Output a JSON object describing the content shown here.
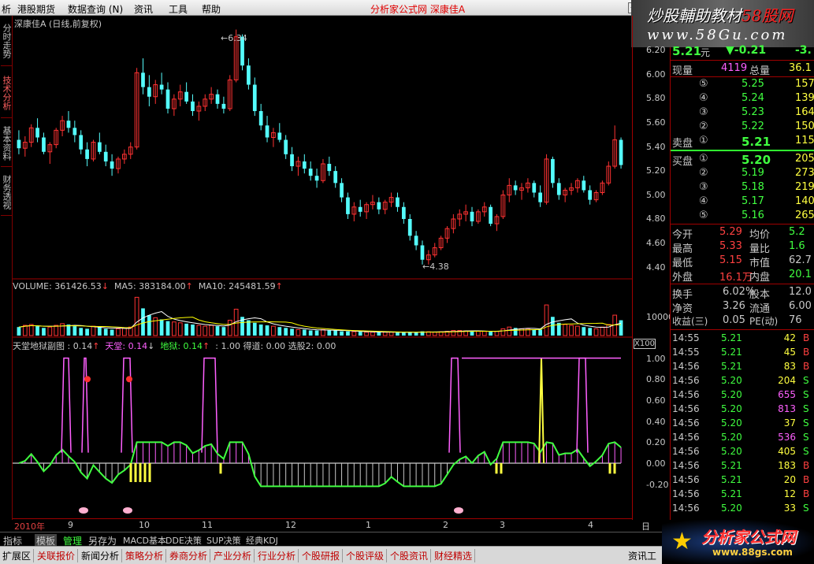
{
  "menu": {
    "items": [
      "析",
      "港股期货",
      "数据查询 (N)",
      "资讯",
      "工具",
      "帮助"
    ],
    "app_title": "分析家公式网  深康佳A",
    "min_button": "—"
  },
  "watermark": {
    "line1_a": "炒股輔助教材",
    "line1_b": "58股网",
    "line2": "www.58Gu.com"
  },
  "left_tabs": [
    "分时走势",
    "技术分析",
    "基本资料",
    "财务透视"
  ],
  "price_panel": {
    "title": "深康佳A (日线,前复权)",
    "high_label": "6.34",
    "low_label": "4.38",
    "y_ticks": [
      "6.20",
      "6.00",
      "5.80",
      "5.60",
      "5.40",
      "5.20",
      "5.00",
      "4.80",
      "4.60",
      "4.40"
    ]
  },
  "volume_panel": {
    "vol_label": "VOLUME: 361426.53",
    "ma5_label": "MA5: 383184.00",
    "ma10_label": "MA10: 245481.59",
    "y_tick": "10000",
    "y_unit": "X100"
  },
  "indicator_panel": {
    "name": "天堂地狱副图 : 0.14",
    "tiantang": "天堂: 0.14",
    "diyu": "地狱: 0.14",
    "rest": ": 1.00 得道: 0.00 选股2: 0.00",
    "y_ticks": [
      "1.00",
      "0.80",
      "0.60",
      "0.40",
      "0.20",
      "0.00",
      "-0.20"
    ]
  },
  "x_axis": {
    "labels": [
      "2010年",
      "9",
      "10",
      "11",
      "12",
      "1",
      "2",
      "3",
      "4"
    ],
    "period": "日线"
  },
  "quote": {
    "price": "5.21",
    "unit": "元",
    "change": "▼-0.21",
    "pct": "-3.",
    "xianliang_label": "现量",
    "xianliang": "4119",
    "zongliang_label": "总量",
    "zongliang": "36.1",
    "sell_label": "卖盘",
    "buy_label": "买盘",
    "sells": [
      {
        "lvl": "⑤",
        "price": "5.25",
        "vol": "157"
      },
      {
        "lvl": "④",
        "price": "5.24",
        "vol": "139"
      },
      {
        "lvl": "③",
        "price": "5.23",
        "vol": "164"
      },
      {
        "lvl": "②",
        "price": "5.22",
        "vol": "150"
      },
      {
        "lvl": "①",
        "price": "5.21",
        "vol": "115"
      }
    ],
    "buys": [
      {
        "lvl": "①",
        "price": "5.20",
        "vol": "205"
      },
      {
        "lvl": "②",
        "price": "5.19",
        "vol": "273"
      },
      {
        "lvl": "③",
        "price": "5.18",
        "vol": "219"
      },
      {
        "lvl": "④",
        "price": "5.17",
        "vol": "140"
      },
      {
        "lvl": "⑤",
        "price": "5.16",
        "vol": "265"
      }
    ],
    "stats": [
      {
        "k1": "今开",
        "v1": "5.29",
        "k2": "均价",
        "v2": "5.2"
      },
      {
        "k1": "最高",
        "v1": "5.33",
        "k2": "量比",
        "v2": "1.6"
      },
      {
        "k1": "最低",
        "v1": "5.15",
        "k2": "市值",
        "v2": "62.7"
      },
      {
        "k1": "外盘",
        "v1": "16.1万",
        "k2": "内盘",
        "v2": "20.1"
      }
    ],
    "stats2": [
      {
        "k1": "换手",
        "v1": "6.02%",
        "k2": "股本",
        "v2": "12.0"
      },
      {
        "k1": "净资",
        "v1": "3.26",
        "k2": "流通",
        "v2": "6.00"
      },
      {
        "k1": "收益(三)",
        "v1": "0.05",
        "k2": "PE(动)",
        "v2": "76"
      }
    ],
    "ticks": [
      {
        "t": "14:55",
        "p": "5.21",
        "v": "42",
        "s": "B"
      },
      {
        "t": "14:55",
        "p": "5.21",
        "v": "45",
        "s": "B"
      },
      {
        "t": "14:56",
        "p": "5.21",
        "v": "83",
        "s": "B"
      },
      {
        "t": "14:56",
        "p": "5.20",
        "v": "204",
        "s": "S"
      },
      {
        "t": "14:56",
        "p": "5.20",
        "v": "655",
        "s": "S"
      },
      {
        "t": "14:56",
        "p": "5.20",
        "v": "813",
        "s": "S"
      },
      {
        "t": "14:56",
        "p": "5.20",
        "v": "37",
        "s": "S"
      },
      {
        "t": "14:56",
        "p": "5.20",
        "v": "536",
        "s": "S"
      },
      {
        "t": "14:56",
        "p": "5.20",
        "v": "405",
        "s": "S"
      },
      {
        "t": "14:56",
        "p": "5.21",
        "v": "183",
        "s": "B"
      },
      {
        "t": "14:56",
        "p": "5.21",
        "v": "20",
        "s": "B"
      },
      {
        "t": "14:56",
        "p": "5.21",
        "v": "12",
        "s": "B"
      },
      {
        "t": "14:56",
        "p": "5.20",
        "v": "33",
        "s": "S"
      }
    ]
  },
  "bottom_tabs": [
    "指标",
    "模板",
    "管理",
    "另存为",
    "MACD基本",
    "DDE决策",
    "SUP决策",
    "经典KDJ"
  ],
  "bottom_bar": [
    "扩展区",
    "关联报价",
    "新闻分析",
    "策略分析",
    "券商分析",
    "产业分析",
    "行业分析",
    "个股研报",
    "个股评级",
    "个股资讯",
    "财经精选",
    "资讯工"
  ],
  "logo": {
    "line1": "分析家公式网",
    "line2": "www.88gs.com"
  },
  "colors": {
    "up": "#ff3232",
    "down": "#54fcfc",
    "ma_white": "#ffffff",
    "ma_yellow": "#ffff00",
    "pink": "#ff60ff",
    "green": "#40ff40",
    "axis_red": "#a00000"
  },
  "chart_data": [
    {
      "type": "candlestick",
      "title": "深康佳A (日线,前复权)",
      "ylim": [
        4.3,
        6.35
      ],
      "ohlc": [
        [
          5.42,
          5.5,
          5.3,
          5.35
        ],
        [
          5.35,
          5.45,
          5.28,
          5.4
        ],
        [
          5.4,
          5.55,
          5.36,
          5.52
        ],
        [
          5.52,
          5.6,
          5.4,
          5.44
        ],
        [
          5.44,
          5.48,
          5.3,
          5.32
        ],
        [
          5.32,
          5.4,
          5.22,
          5.38
        ],
        [
          5.38,
          5.52,
          5.35,
          5.5
        ],
        [
          5.5,
          5.62,
          5.45,
          5.58
        ],
        [
          5.58,
          5.66,
          5.48,
          5.52
        ],
        [
          5.52,
          5.58,
          5.4,
          5.46
        ],
        [
          5.46,
          5.5,
          5.3,
          5.34
        ],
        [
          5.34,
          5.4,
          5.2,
          5.26
        ],
        [
          5.26,
          5.42,
          5.24,
          5.4
        ],
        [
          5.4,
          5.48,
          5.3,
          5.32
        ],
        [
          5.32,
          5.38,
          5.2,
          5.24
        ],
        [
          5.24,
          5.3,
          5.12,
          5.18
        ],
        [
          5.18,
          5.28,
          5.14,
          5.26
        ],
        [
          5.26,
          5.34,
          5.22,
          5.3
        ],
        [
          5.3,
          5.4,
          5.26,
          5.36
        ],
        [
          5.36,
          6.02,
          5.34,
          5.98
        ],
        [
          5.98,
          6.1,
          5.8,
          5.86
        ],
        [
          5.86,
          5.96,
          5.7,
          5.78
        ],
        [
          5.78,
          5.92,
          5.72,
          5.88
        ],
        [
          5.88,
          5.98,
          5.8,
          5.84
        ],
        [
          5.84,
          5.9,
          5.64,
          5.68
        ],
        [
          5.68,
          5.8,
          5.62,
          5.76
        ],
        [
          5.76,
          5.88,
          5.7,
          5.82
        ],
        [
          5.82,
          5.9,
          5.72,
          5.74
        ],
        [
          5.74,
          5.8,
          5.62,
          5.66
        ],
        [
          5.66,
          5.74,
          5.58,
          5.7
        ],
        [
          5.7,
          5.8,
          5.66,
          5.76
        ],
        [
          5.76,
          5.86,
          5.72,
          5.8
        ],
        [
          5.8,
          5.84,
          5.68,
          5.72
        ],
        [
          5.72,
          5.78,
          5.64,
          5.68
        ],
        [
          5.68,
          5.96,
          5.66,
          5.92
        ],
        [
          5.92,
          6.34,
          5.9,
          6.28
        ],
        [
          6.28,
          6.3,
          6.0,
          6.04
        ],
        [
          6.04,
          6.1,
          5.84,
          5.88
        ],
        [
          5.88,
          5.94,
          5.62,
          5.66
        ],
        [
          5.66,
          5.72,
          5.5,
          5.54
        ],
        [
          5.54,
          5.62,
          5.4,
          5.44
        ],
        [
          5.44,
          5.52,
          5.36,
          5.48
        ],
        [
          5.48,
          5.56,
          5.4,
          5.42
        ],
        [
          5.42,
          5.46,
          5.26,
          5.3
        ],
        [
          5.3,
          5.36,
          5.16,
          5.2
        ],
        [
          5.2,
          5.28,
          5.12,
          5.24
        ],
        [
          5.24,
          5.3,
          5.14,
          5.18
        ],
        [
          5.18,
          5.24,
          5.08,
          5.12
        ],
        [
          5.12,
          5.18,
          5.02,
          5.08
        ],
        [
          5.08,
          5.26,
          5.06,
          5.22
        ],
        [
          5.22,
          5.28,
          5.12,
          5.16
        ],
        [
          5.16,
          5.2,
          5.02,
          5.06
        ],
        [
          5.06,
          5.1,
          4.9,
          4.94
        ],
        [
          4.94,
          4.98,
          4.76,
          4.8
        ],
        [
          4.8,
          4.9,
          4.74,
          4.86
        ],
        [
          4.86,
          4.92,
          4.78,
          4.82
        ],
        [
          4.82,
          4.9,
          4.76,
          4.88
        ],
        [
          4.88,
          4.96,
          4.84,
          4.9
        ],
        [
          4.9,
          4.94,
          4.8,
          4.84
        ],
        [
          4.84,
          4.92,
          4.8,
          4.9
        ],
        [
          4.9,
          4.98,
          4.86,
          4.94
        ],
        [
          4.94,
          4.98,
          4.82,
          4.86
        ],
        [
          4.86,
          4.9,
          4.72,
          4.76
        ],
        [
          4.76,
          4.8,
          4.58,
          4.62
        ],
        [
          4.62,
          4.66,
          4.5,
          4.54
        ],
        [
          4.54,
          4.58,
          4.38,
          4.42
        ],
        [
          4.42,
          4.5,
          4.38,
          4.46
        ],
        [
          4.46,
          4.56,
          4.44,
          4.52
        ],
        [
          4.52,
          4.62,
          4.5,
          4.6
        ],
        [
          4.6,
          4.7,
          4.56,
          4.68
        ],
        [
          4.68,
          4.8,
          4.64,
          4.76
        ],
        [
          4.76,
          4.84,
          4.7,
          4.8
        ],
        [
          4.8,
          4.88,
          4.74,
          4.82
        ],
        [
          4.82,
          4.86,
          4.7,
          4.74
        ],
        [
          4.74,
          4.84,
          4.72,
          4.82
        ],
        [
          4.82,
          4.9,
          4.78,
          4.86
        ],
        [
          4.86,
          4.88,
          4.7,
          4.72
        ],
        [
          4.72,
          4.8,
          4.66,
          4.78
        ],
        [
          4.78,
          5.0,
          4.76,
          4.96
        ],
        [
          4.96,
          5.1,
          4.9,
          5.04
        ],
        [
          5.04,
          5.08,
          4.96,
          5.0
        ],
        [
          5.0,
          5.06,
          4.92,
          5.02
        ],
        [
          5.02,
          5.1,
          4.98,
          5.06
        ],
        [
          5.06,
          5.08,
          4.94,
          4.98
        ],
        [
          4.98,
          5.04,
          4.86,
          4.9
        ],
        [
          4.9,
          5.3,
          4.88,
          5.26
        ],
        [
          5.26,
          5.28,
          5.02,
          5.06
        ],
        [
          5.06,
          5.1,
          4.92,
          4.96
        ],
        [
          4.96,
          5.02,
          4.9,
          5.0
        ],
        [
          5.0,
          5.06,
          4.96,
          5.02
        ],
        [
          5.02,
          5.1,
          4.98,
          5.08
        ],
        [
          5.08,
          5.12,
          4.98,
          5.0
        ],
        [
          5.0,
          5.04,
          4.88,
          4.92
        ],
        [
          4.92,
          5.0,
          4.9,
          4.98
        ],
        [
          4.98,
          5.08,
          4.96,
          5.06
        ],
        [
          5.06,
          5.24,
          5.04,
          5.2
        ],
        [
          5.2,
          5.54,
          5.18,
          5.42
        ],
        [
          5.42,
          5.44,
          5.18,
          5.21
        ]
      ]
    },
    {
      "type": "bar",
      "title": "VOLUME",
      "series": [
        {
          "name": "VOLUME",
          "values": [
            2,
            2.4,
            2.6,
            2.2,
            1.8,
            2.0,
            2.4,
            2.8,
            2.6,
            2.2,
            1.8,
            1.6,
            2.2,
            2.0,
            1.6,
            1.4,
            1.6,
            1.8,
            2.0,
            9.0,
            6.4,
            4.8,
            4.2,
            3.8,
            3.4,
            3.2,
            3.0,
            2.8,
            2.6,
            2.4,
            2.2,
            2.4,
            2.2,
            2.0,
            3.6,
            6.2,
            4.4,
            3.6,
            3.0,
            2.6,
            2.4,
            2.2,
            2.0,
            1.8,
            1.6,
            1.4,
            1.4,
            1.2,
            1.2,
            1.4,
            1.2,
            1.2,
            1.0,
            1.0,
            0.9,
            0.9,
            0.8,
            0.8,
            0.8,
            0.8,
            0.8,
            0.7,
            0.7,
            0.8,
            0.8,
            1.0,
            0.9,
            0.8,
            0.9,
            1.0,
            1.2,
            1.2,
            1.1,
            1.0,
            1.0,
            1.0,
            0.9,
            1.0,
            1.6,
            2.0,
            1.8,
            1.6,
            1.6,
            1.4,
            1.4,
            7.2,
            4.4,
            3.0,
            2.6,
            2.4,
            2.2,
            2.0,
            1.8,
            1.6,
            2.0,
            2.6,
            4.8,
            3.6
          ]
        }
      ]
    },
    {
      "type": "line",
      "title": "天堂地狱副图",
      "ylim": [
        -0.3,
        1.05
      ]
    }
  ]
}
